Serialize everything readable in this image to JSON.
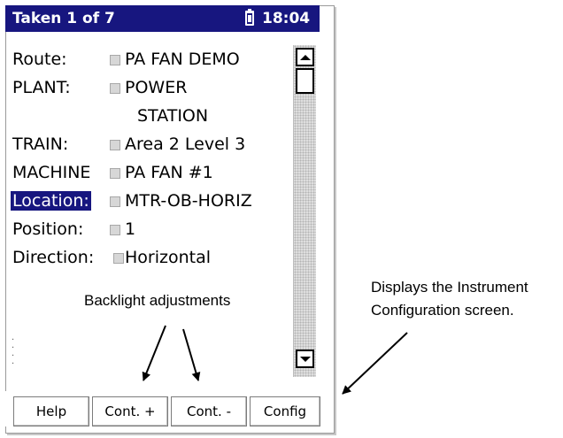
{
  "titlebar": {
    "title": "Taken 1 of 7",
    "time": "18:04"
  },
  "fields": [
    {
      "label": "Route:",
      "value": "PA FAN DEMO",
      "selected": false
    },
    {
      "label": "PLANT:",
      "value": "POWER",
      "value_line2": "STATION",
      "selected": false
    },
    {
      "label": "TRAIN:",
      "value": "Area 2 Level 3",
      "selected": false
    },
    {
      "label": "MACHINE",
      "value": "PA FAN #1",
      "selected": false
    },
    {
      "label": "Location:",
      "value": "MTR-OB-HORIZ",
      "selected": true
    },
    {
      "label": "Position:",
      "value": "1",
      "selected": false
    },
    {
      "label": "Direction:",
      "value": "Horizontal",
      "selected": false
    }
  ],
  "buttons": {
    "help": "Help",
    "cont_plus": "Cont. +",
    "cont_minus": "Cont. -",
    "config": "Config"
  },
  "annotations": {
    "backlight": "Backlight adjustments",
    "config_line1": "Displays the Instrument",
    "config_line2": "Configuration screen."
  },
  "colors": {
    "titlebar": "#17167f",
    "selection": "#17167f"
  }
}
